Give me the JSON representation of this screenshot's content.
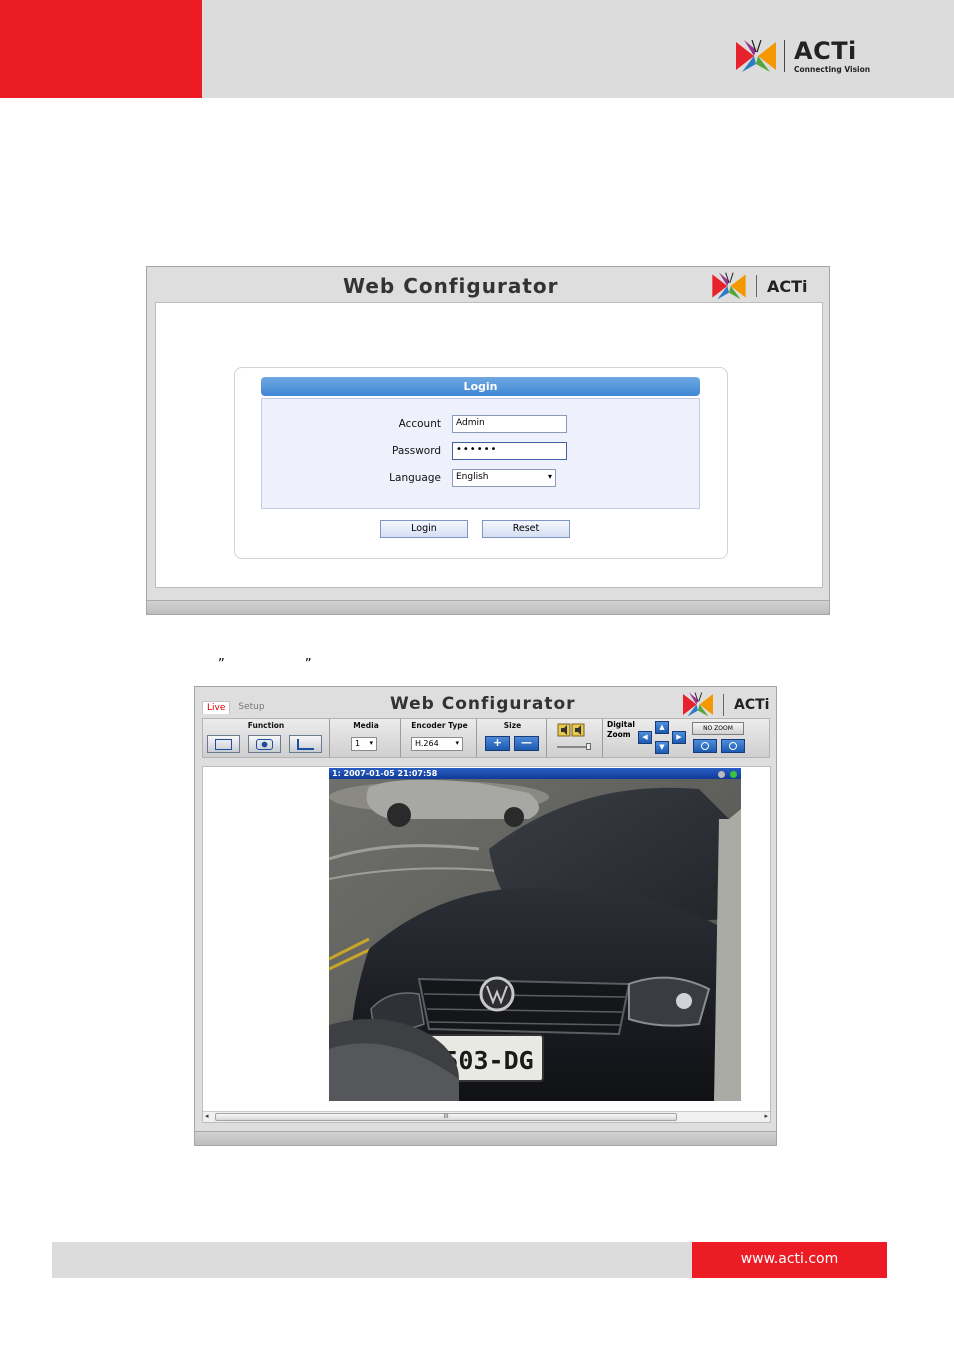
{
  "header": {
    "brand_name": "ACTi",
    "brand_tagline": "Connecting Vision"
  },
  "login_window": {
    "title": "Web Configurator",
    "logo_text": "ACTi",
    "panel_title": "Login",
    "fields": {
      "account_label": "Account",
      "account_value": "Admin",
      "password_label": "Password",
      "password_value": "••••••",
      "language_label": "Language",
      "language_value": "English"
    },
    "buttons": {
      "login": "Login",
      "reset": "Reset"
    }
  },
  "quote_marks": "” ”",
  "live_window": {
    "title": "Web Configurator",
    "logo_text": "ACTi",
    "tabs": [
      {
        "label": "Live",
        "active": true
      },
      {
        "label": "Setup",
        "active": false
      }
    ],
    "toolbar": {
      "function_label": "Function",
      "media_label": "Media",
      "media_value": "1",
      "encoder_label": "Encoder Type",
      "encoder_value": "H.264",
      "size_label": "Size",
      "size_plus": "+",
      "size_minus": "—",
      "digital_zoom_label_1": "Digital",
      "digital_zoom_label_2": "Zoom",
      "no_zoom_label": "NO ZOOM"
    },
    "video": {
      "overlay_text": "1:  2007-01-05 21:07:58",
      "plate_text": "1503-DG",
      "scroll_grip": "III"
    }
  },
  "footer": {
    "url": "www.acti.com"
  },
  "colors": {
    "accent_red": "#ec1c24",
    "header_gray": "#dcdcdc",
    "login_blue": "#4a8fd8"
  }
}
